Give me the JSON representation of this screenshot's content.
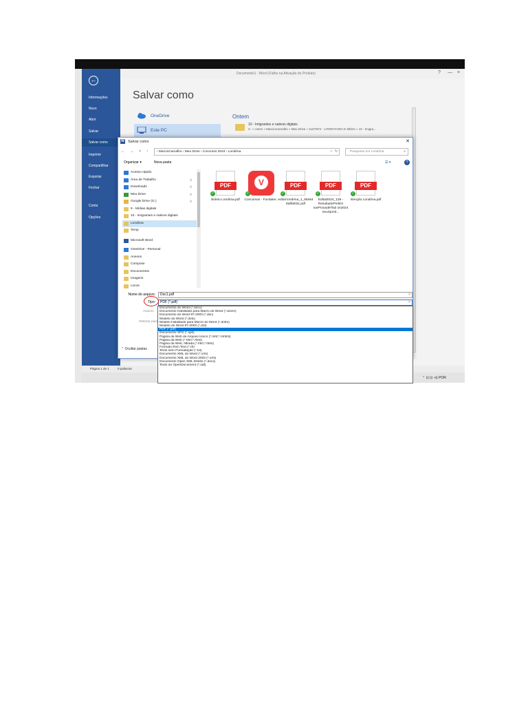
{
  "word": {
    "window_title": "Documento1 - Word (Falha na Ativação do Produto)",
    "controls": [
      "?",
      "—",
      "×"
    ]
  },
  "backstage": {
    "items": [
      "Informações",
      "Novo",
      "Abrir",
      "Salvar",
      "Salvar como",
      "Imprimir",
      "Compartilhar",
      "Exportar",
      "Fechar",
      "Conta",
      "Opções"
    ],
    "active_index": 4
  },
  "saveas": {
    "title": "Salvar como",
    "locations": [
      "OneDrive",
      "Este PC"
    ],
    "recent_heading": "Ontem",
    "recent_item": "10 - Imigrantes e nativos digitais",
    "recent_path": "C: » Users » MarcioCarvalho » Meu Drive » 2LET872 · LITERATURA E MÍDIA » 10 - Imigra..."
  },
  "dialog": {
    "title": "Salvar como",
    "address": "›  MarcioCarvalho  ›  Meu Drive  ›  Concurso 2024  ›  Londrina",
    "search_placeholder": "Pesquisar em Londrina",
    "organize": "Organizar ▾",
    "new_folder": "Nova pasta",
    "nav_items": [
      {
        "label": "Acesso rápido",
        "icon": "star-icon",
        "color": "#2b79d6"
      },
      {
        "label": "Área de Trabalho",
        "icon": "desktop-icon",
        "color": "#2b79d6",
        "pinned": true
      },
      {
        "label": "Downloads",
        "icon": "download-icon",
        "color": "#2b79d6",
        "pinned": true
      },
      {
        "label": "Meu Drive",
        "icon": "drive-icon",
        "color": "#3c9a3c",
        "pinned": true
      },
      {
        "label": "Google Drive (G:)",
        "icon": "drive-icon",
        "color": "#e8b53c",
        "pinned": true
      },
      {
        "label": "9 - Mídias digitais",
        "icon": "folder-icon",
        "color": "#e8c45c"
      },
      {
        "label": "10 - Imigrantes e nativos digitais",
        "icon": "folder-icon",
        "color": "#e8c45c"
      },
      {
        "label": "Londrina",
        "icon": "folder-icon",
        "color": "#e8c45c",
        "selected": true
      },
      {
        "label": "Temp",
        "icon": "folder-icon",
        "color": "#e8c45c"
      },
      {
        "label": "Microsoft Word",
        "icon": "word-icon",
        "color": "#2b579a"
      },
      {
        "label": "OneDrive - Personal",
        "icon": "cloud-icon",
        "color": "#2b79d6"
      },
      {
        "label": "Anexos",
        "icon": "folder-icon",
        "color": "#e8c45c"
      },
      {
        "label": "Compose",
        "icon": "folder-icon",
        "color": "#e8c45c"
      },
      {
        "label": "Documentos",
        "icon": "folder-icon",
        "color": "#e8c45c"
      },
      {
        "label": "Imagens",
        "icon": "folder-icon",
        "color": "#e8c45c"
      },
      {
        "label": "Livros",
        "icon": "folder-icon",
        "color": "#e8c45c"
      }
    ],
    "files": [
      {
        "name": "Boleto Londrina.pdf",
        "type": "pdf"
      },
      {
        "name": "Concursos - Fundatec",
        "type": "vivaldi"
      },
      {
        "name": "edital londrina_1_65e54 8afb8031.pdf",
        "type": "pdf"
      },
      {
        "name": "Edital2024_129 - ResultadoPrelimi narProvadeTitul os2024 neuSpm0...",
        "type": "pdf"
      },
      {
        "name": "Isenção Londrina.pdf",
        "type": "pdf"
      }
    ],
    "filename_label": "Nome do arquivo:",
    "filename_value": "Doc1.pdf",
    "type_label": "Tipo:",
    "type_value": "PDF (*.pdf)",
    "authors_label": "Autores:",
    "optimize_label": "Otimizar para:",
    "hide_folders": "⌃  Ocultar pastas"
  },
  "type_options": [
    "Documento do Word (*.docx)",
    "Documento Habilitado para Macro do Word (*.docm)",
    "Documento do Word 97-2003 (*.doc)",
    "Modelo do Word (*.dotx)",
    "Modelo Habilitado para Macro do Word (*.dotm)",
    "Modelo do Word 97-2003 (*.dot)",
    "PDF (*.pdf)",
    "Documento XPS (*.xps)",
    "Página da Web de Arquivo Único (*.mht;*.mhtml)",
    "Página da Web (*.htm;*.html)",
    "Página da Web, filtrada (*.htm;*.html)",
    "Formato Rich Text (*.rtf)",
    "Texto sem Formatação (*.txt)",
    "Documento XML do Word (*.xml)",
    "Documento XML do Word 2003 (*.xml)",
    "Documento Open XML Estrito (*.docx)",
    "Texto do OpenDocument (*.odt)"
  ],
  "type_selected_index": 6,
  "status": {
    "page": "Página 1 de 1",
    "words": "0 palavras"
  },
  "tray": "⌃  ⊡  ⊡  ⊲)  POR"
}
